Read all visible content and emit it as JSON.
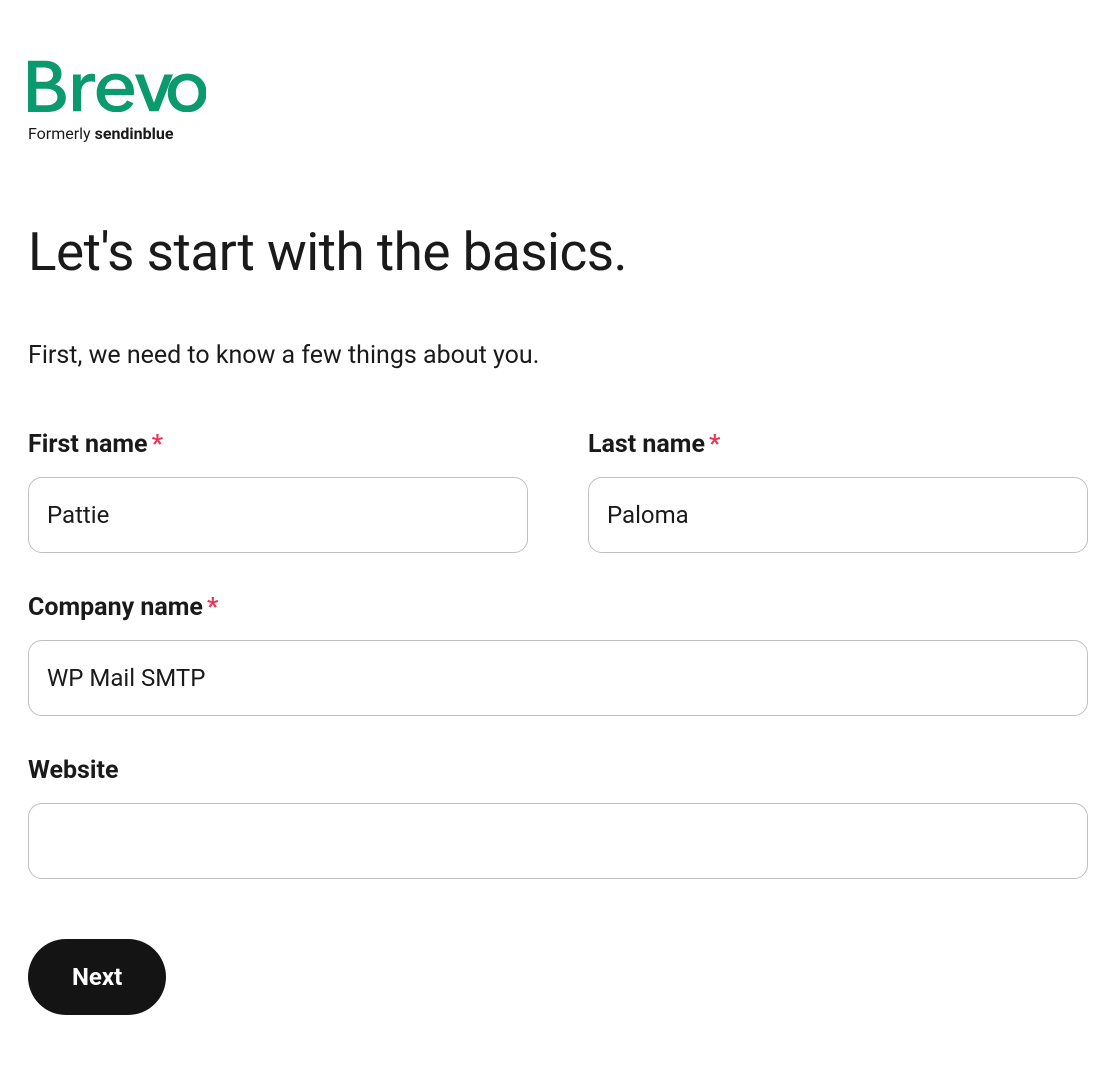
{
  "brand": {
    "name": "Brevo",
    "subtitle_prefix": "Formerly ",
    "subtitle_bold": "sendinblue",
    "accent": "#0b996e"
  },
  "page": {
    "title": "Let's start with the basics.",
    "intro": "First, we need to know a few things about you."
  },
  "form": {
    "first_name": {
      "label": "First name",
      "required": true,
      "value": "Pattie"
    },
    "last_name": {
      "label": "Last name",
      "required": true,
      "value": "Paloma"
    },
    "company_name": {
      "label": "Company name",
      "required": true,
      "value": "WP Mail SMTP"
    },
    "website": {
      "label": "Website",
      "required": false,
      "value": ""
    }
  },
  "actions": {
    "next_label": "Next"
  },
  "required_marker": "*"
}
